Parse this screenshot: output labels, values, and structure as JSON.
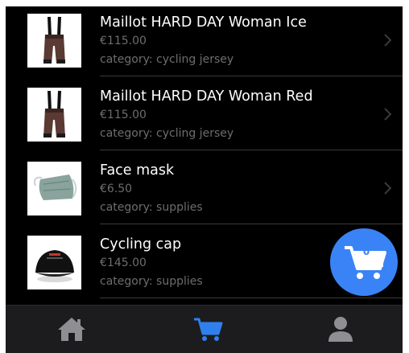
{
  "products": [
    {
      "name": "Maillot HARD DAY Woman Ice",
      "price": "€115.00",
      "category": "category: cycling jersey",
      "image": "bib-shorts-image"
    },
    {
      "name": "Maillot HARD DAY Woman Red",
      "price": "€115.00",
      "category": "category: cycling jersey",
      "image": "bib-shorts-image"
    },
    {
      "name": "Face mask",
      "price": "€6.50",
      "category": "category: supplies",
      "image": "face-mask-image"
    },
    {
      "name": "Cycling cap",
      "price": "€145.00",
      "category": "category: supplies",
      "image": "cycling-cap-image"
    }
  ],
  "cart": {
    "count": "0",
    "icon": "cart-icon",
    "color": "#3a83f6"
  },
  "tabbar": {
    "items": [
      {
        "icon": "home-icon",
        "active": false
      },
      {
        "icon": "cart-icon",
        "active": true
      },
      {
        "icon": "profile-icon",
        "active": false
      }
    ],
    "active_color": "#2f80ed",
    "inactive_color": "#8e8e93"
  },
  "colors": {
    "background": "#000000",
    "text": "#ffffff",
    "subtext": "#6d6d72",
    "separator": "#3a3a3c"
  }
}
